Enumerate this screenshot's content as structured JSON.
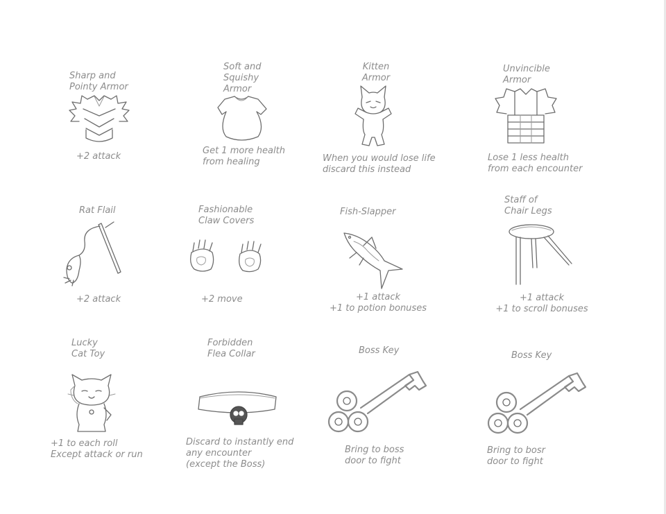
{
  "items": [
    {
      "name": "Sharp and\nPointy Armor",
      "effect": "+2 attack"
    },
    {
      "name": "Soft and\nSquishy\nArmor",
      "effect": "Get 1 more health\nfrom healing"
    },
    {
      "name": "Kitten\nArmor",
      "effect": "When you would lose life\ndiscard this instead"
    },
    {
      "name": "Unvincible\nArmor",
      "effect": "Lose 1 less health\nfrom each encounter"
    },
    {
      "name": "Rat Flail",
      "effect": "+2 attack"
    },
    {
      "name": "Fashionable\nClaw Covers",
      "effect": "+2 move"
    },
    {
      "name": "Fish-Slapper",
      "effect": "+1 attack\n+1 to potion bonuses"
    },
    {
      "name": "Staff of\nChair Legs",
      "effect": "+1 attack\n+1 to scroll bonuses"
    },
    {
      "name": "Lucky\nCat Toy",
      "effect": "+1 to each roll\nExcept attack or run"
    },
    {
      "name": "Forbidden\nFlea Collar",
      "effect": "Discard to instantly end\nany encounter\n(except the Boss)"
    },
    {
      "name": "Boss Key",
      "effect": "Bring to boss\ndoor to fight"
    },
    {
      "name": "Boss Key",
      "effect": "Bring to bosr\ndoor to fight"
    }
  ],
  "icons": [
    "spiky-armor-icon",
    "shirt-armor-icon",
    "kitten-armor-icon",
    "invincible-armor-icon",
    "rat-flail-icon",
    "claw-covers-icon",
    "fish-slapper-icon",
    "stool-staff-icon",
    "lucky-cat-icon",
    "flea-collar-icon",
    "boss-key-icon",
    "boss-key-icon"
  ]
}
